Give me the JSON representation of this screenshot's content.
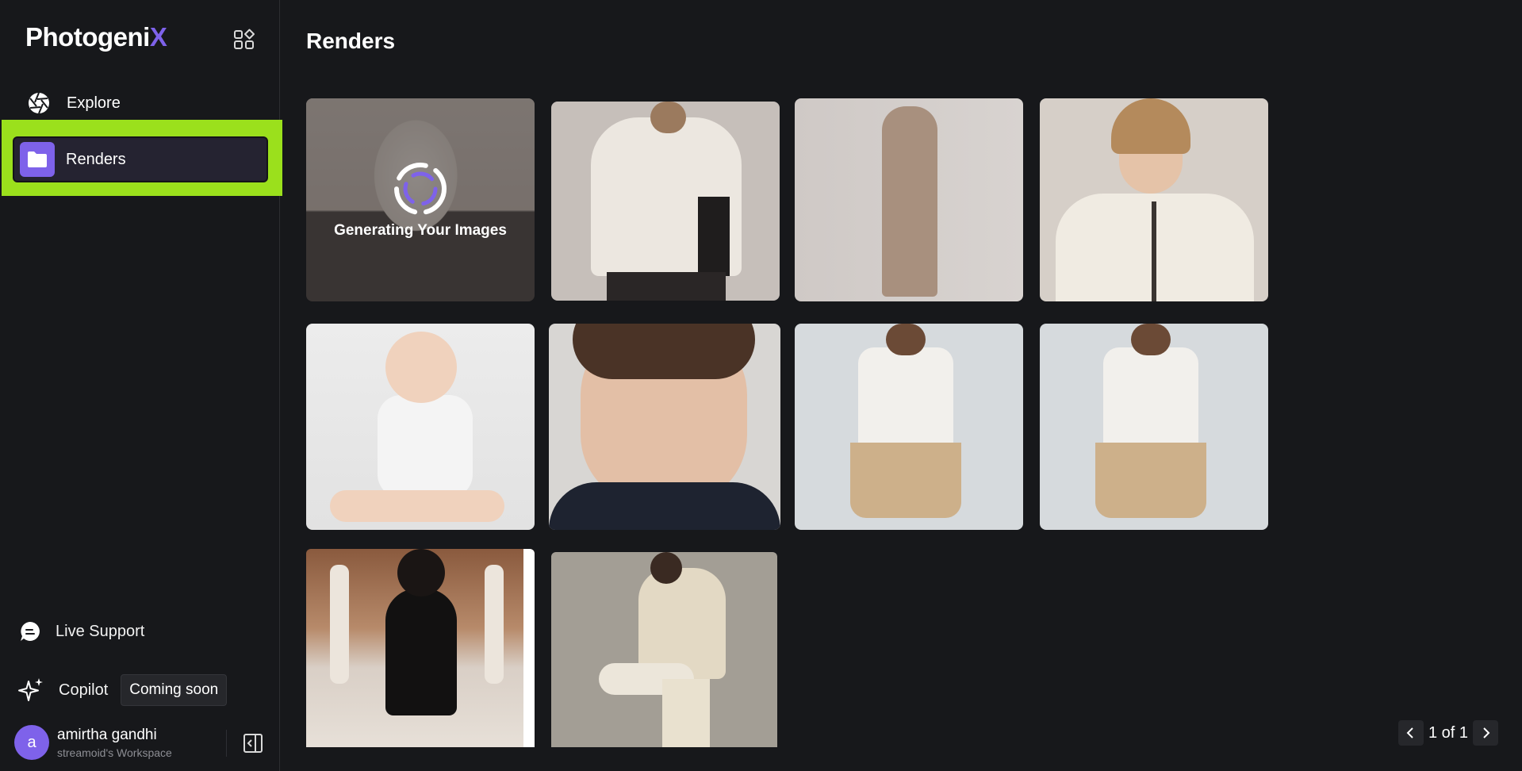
{
  "brand": {
    "name_main": "Photogeni",
    "name_accent": "X",
    "accent_color": "#7e62ea"
  },
  "sidebar": {
    "items": [
      {
        "label": "Explore",
        "icon": "aperture-icon"
      },
      {
        "label": "Renders",
        "icon": "folder-icon",
        "active": true
      }
    ],
    "highlight_color": "#9be01c",
    "live_support_label": "Live Support",
    "copilot_label": "Copilot",
    "copilot_badge": "Coming soon",
    "user": {
      "initial": "a",
      "name": "amirtha gandhi",
      "workspace": "streamoid's Workspace"
    }
  },
  "main": {
    "title": "Renders",
    "loading_text": "Generating Your Images",
    "images": [
      {
        "name": "woman-jacket-generating",
        "status": "generating"
      },
      {
        "name": "calvin-klein-jacket-back"
      },
      {
        "name": "hoodie-dress-side"
      },
      {
        "name": "woman-white-jacket-portrait"
      },
      {
        "name": "toddler-white-shirt"
      },
      {
        "name": "boy-face-closeup"
      },
      {
        "name": "woman-white-top-skirt-1"
      },
      {
        "name": "woman-white-top-skirt-2"
      },
      {
        "name": "girl-black-dress"
      },
      {
        "name": "woman-cream-suit-stool"
      }
    ],
    "pagination": {
      "text": "1 of 1"
    }
  }
}
